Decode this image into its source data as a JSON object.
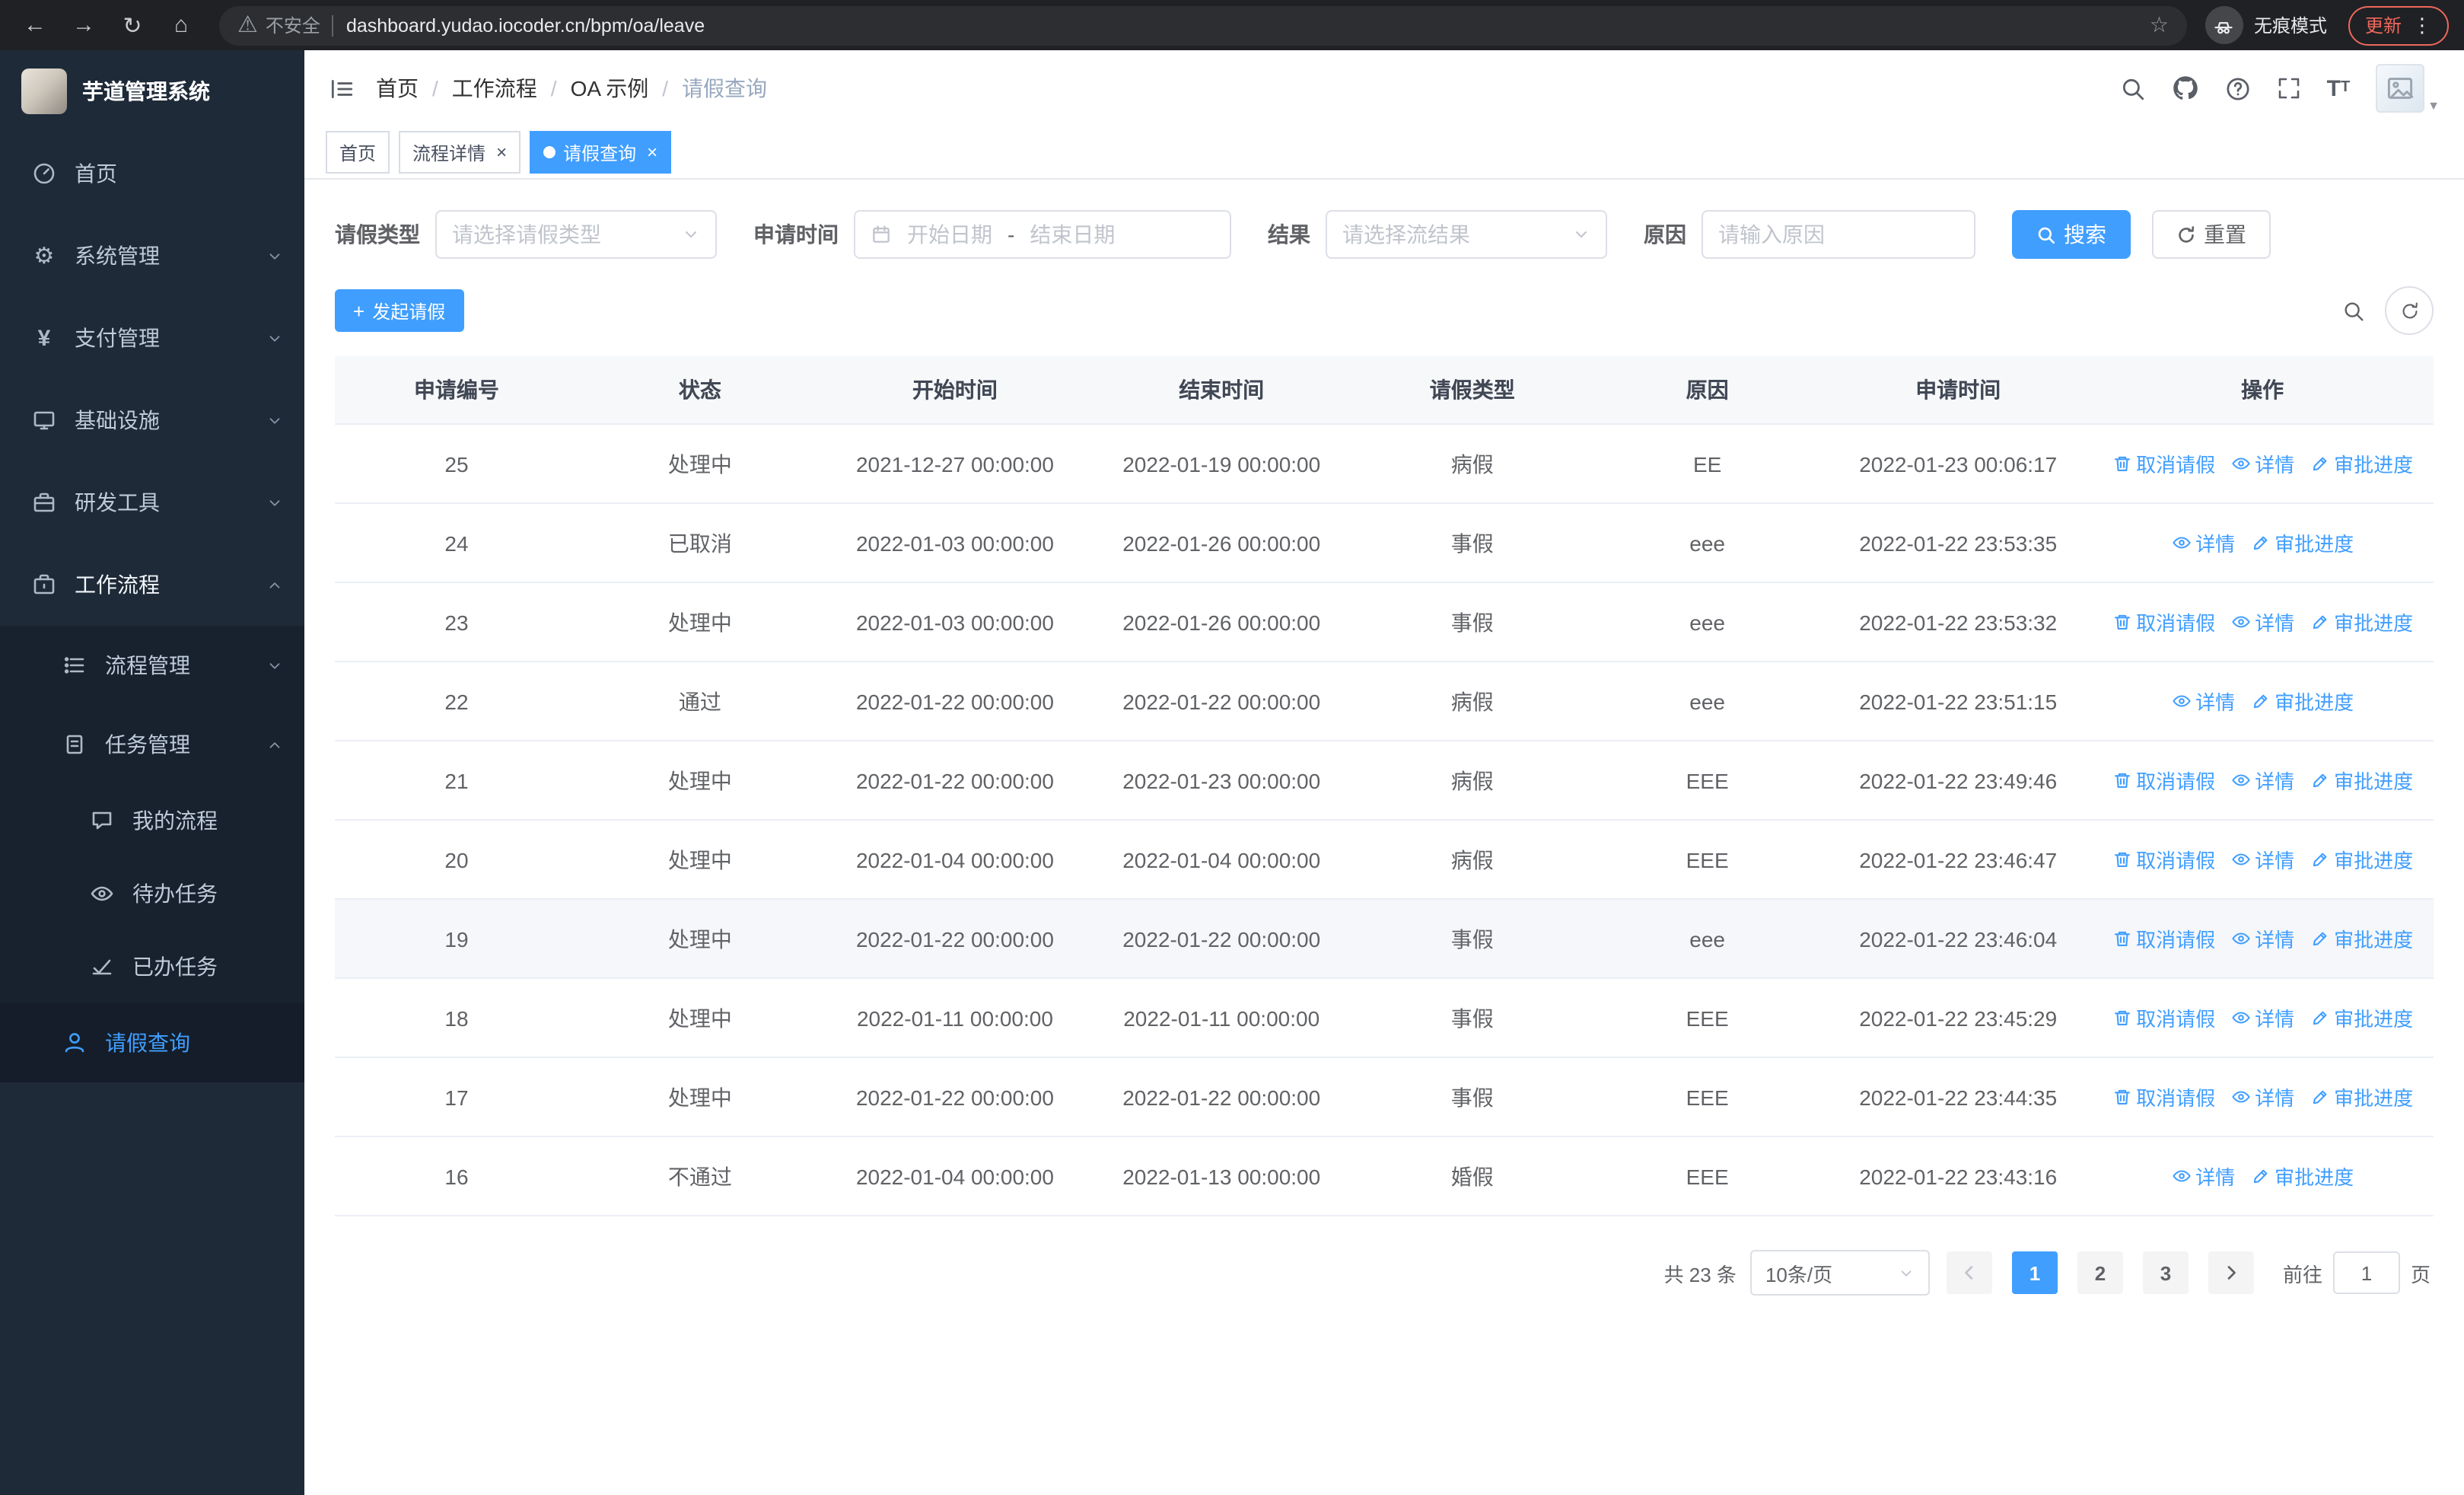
{
  "browser": {
    "security_warning": "不安全",
    "url": "dashboard.yudao.iocoder.cn/bpm/oa/leave",
    "incognito_label": "无痕模式",
    "update_label": "更新"
  },
  "icons": {
    "back": "←",
    "forward": "→",
    "reload": "↻",
    "home": "⌂",
    "warning": "⚠",
    "star": "☆",
    "dots_vertical": "⋮",
    "close": "×",
    "slash": "/",
    "gear": "⚙",
    "yen": "¥",
    "plus": "+",
    "caret_down_small": "▼",
    "font_large": "T",
    "font_small": "T"
  },
  "sidebar": {
    "title": "芋道管理系统",
    "items": [
      {
        "label": "首页"
      },
      {
        "label": "系统管理"
      },
      {
        "label": "支付管理"
      },
      {
        "label": "基础设施"
      },
      {
        "label": "研发工具"
      },
      {
        "label": "工作流程"
      },
      {
        "label": "流程管理"
      },
      {
        "label": "任务管理"
      },
      {
        "label": "我的流程"
      },
      {
        "label": "待办任务"
      },
      {
        "label": "已办任务"
      },
      {
        "label": "请假查询"
      }
    ]
  },
  "header": {
    "breadcrumb": [
      "首页",
      "工作流程",
      "OA 示例",
      "请假查询"
    ]
  },
  "tabs": [
    {
      "label": "首页"
    },
    {
      "label": "流程详情"
    },
    {
      "label": "请假查询"
    }
  ],
  "filters": {
    "leave_type_label": "请假类型",
    "leave_type_placeholder": "请选择请假类型",
    "apply_time_label": "申请时间",
    "start_date_placeholder": "开始日期",
    "range_separator": "-",
    "end_date_placeholder": "结束日期",
    "result_label": "结果",
    "result_placeholder": "请选择流结果",
    "reason_label": "原因",
    "reason_placeholder": "请输入原因",
    "search_label": "搜索",
    "reset_label": "重置"
  },
  "toolbar": {
    "create_label": "发起请假"
  },
  "table": {
    "columns": [
      "申请编号",
      "状态",
      "开始时间",
      "结束时间",
      "请假类型",
      "原因",
      "申请时间",
      "操作"
    ],
    "column_keys": [
      "id",
      "status",
      "start",
      "end",
      "type",
      "reason",
      "applied"
    ],
    "action_labels": {
      "cancel": "取消请假",
      "detail": "详情",
      "progress": "审批进度"
    },
    "rows": [
      {
        "id": "25",
        "status": "处理中",
        "start": "2021-12-27 00:00:00",
        "end": "2022-01-19 00:00:00",
        "type": "病假",
        "reason": "EE",
        "applied": "2022-01-23 00:06:17",
        "actions": [
          "cancel",
          "detail",
          "progress"
        ],
        "hover": false
      },
      {
        "id": "24",
        "status": "已取消",
        "start": "2022-01-03 00:00:00",
        "end": "2022-01-26 00:00:00",
        "type": "事假",
        "reason": "eee",
        "applied": "2022-01-22 23:53:35",
        "actions": [
          "detail",
          "progress"
        ],
        "hover": false
      },
      {
        "id": "23",
        "status": "处理中",
        "start": "2022-01-03 00:00:00",
        "end": "2022-01-26 00:00:00",
        "type": "事假",
        "reason": "eee",
        "applied": "2022-01-22 23:53:32",
        "actions": [
          "cancel",
          "detail",
          "progress"
        ],
        "hover": false
      },
      {
        "id": "22",
        "status": "通过",
        "start": "2022-01-22 00:00:00",
        "end": "2022-01-22 00:00:00",
        "type": "病假",
        "reason": "eee",
        "applied": "2022-01-22 23:51:15",
        "actions": [
          "detail",
          "progress"
        ],
        "hover": false
      },
      {
        "id": "21",
        "status": "处理中",
        "start": "2022-01-22 00:00:00",
        "end": "2022-01-23 00:00:00",
        "type": "病假",
        "reason": "EEE",
        "applied": "2022-01-22 23:49:46",
        "actions": [
          "cancel",
          "detail",
          "progress"
        ],
        "hover": false
      },
      {
        "id": "20",
        "status": "处理中",
        "start": "2022-01-04 00:00:00",
        "end": "2022-01-04 00:00:00",
        "type": "病假",
        "reason": "EEE",
        "applied": "2022-01-22 23:46:47",
        "actions": [
          "cancel",
          "detail",
          "progress"
        ],
        "hover": false
      },
      {
        "id": "19",
        "status": "处理中",
        "start": "2022-01-22 00:00:00",
        "end": "2022-01-22 00:00:00",
        "type": "事假",
        "reason": "eee",
        "applied": "2022-01-22 23:46:04",
        "actions": [
          "cancel",
          "detail",
          "progress"
        ],
        "hover": true
      },
      {
        "id": "18",
        "status": "处理中",
        "start": "2022-01-11 00:00:00",
        "end": "2022-01-11 00:00:00",
        "type": "事假",
        "reason": "EEE",
        "applied": "2022-01-22 23:45:29",
        "actions": [
          "cancel",
          "detail",
          "progress"
        ],
        "hover": false
      },
      {
        "id": "17",
        "status": "处理中",
        "start": "2022-01-22 00:00:00",
        "end": "2022-01-22 00:00:00",
        "type": "事假",
        "reason": "EEE",
        "applied": "2022-01-22 23:44:35",
        "actions": [
          "cancel",
          "detail",
          "progress"
        ],
        "hover": false
      },
      {
        "id": "16",
        "status": "不通过",
        "start": "2022-01-04 00:00:00",
        "end": "2022-01-13 00:00:00",
        "type": "婚假",
        "reason": "EEE",
        "applied": "2022-01-22 23:43:16",
        "actions": [
          "detail",
          "progress"
        ],
        "hover": false
      }
    ]
  },
  "pagination": {
    "total_text": "共 23 条",
    "page_size": "10条/页",
    "pages": [
      "1",
      "2",
      "3"
    ],
    "active_page": "1",
    "goto_label": "前往",
    "goto_value": "1",
    "goto_suffix": "页"
  },
  "colors": {
    "accent": "#409eff",
    "sidebar_bg": "#1e2a38",
    "submenu_bg": "#18222f",
    "chrome_bg": "#202124",
    "table_header_bg": "#f7f8fa",
    "update_badge": "#ee675c"
  }
}
